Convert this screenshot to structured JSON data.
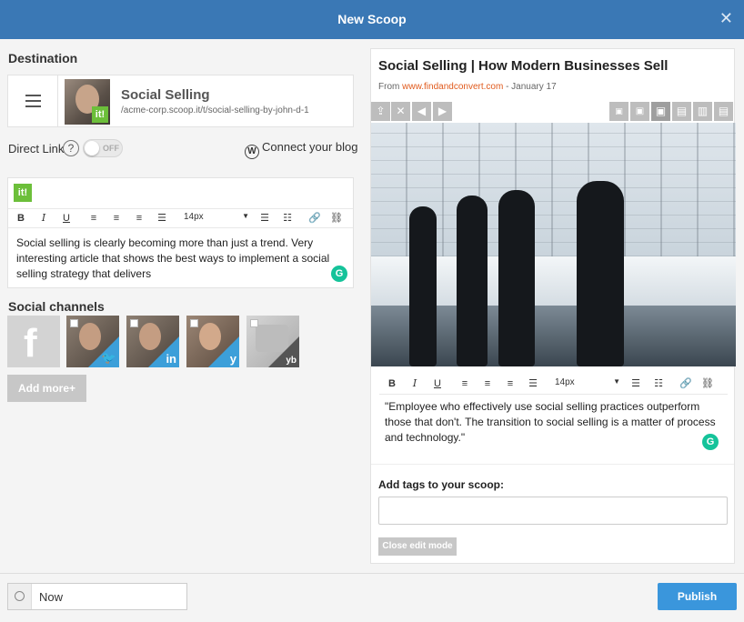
{
  "header": {
    "title": "New Scoop",
    "close_icon": "close-icon"
  },
  "destination": {
    "section_title": "Destination",
    "topic_name": "Social Selling",
    "topic_url": "/acme-corp.scoop.it/t/social-selling-by-john-d-1",
    "badge": "it!"
  },
  "direct_link": {
    "label": "Direct Link",
    "help": "?",
    "toggle": "OFF",
    "connect_blog": "Connect your blog"
  },
  "insight_editor": {
    "badge": "it!",
    "toolbar": {
      "bold": "B",
      "italic": "I",
      "underline": "U",
      "font_size": "14px"
    },
    "text": "Social selling is clearly becoming more than just a trend. Very interesting article that shows the best ways to implement a social selling strategy that delivers",
    "grammarly": "G"
  },
  "social": {
    "section_title": "Social channels",
    "channels": [
      {
        "name": "Facebook",
        "icon": "f"
      },
      {
        "name": "Twitter",
        "icon": "twitter-icon"
      },
      {
        "name": "LinkedIn",
        "icon": "in"
      },
      {
        "name": "Yammer",
        "icon": "y"
      },
      {
        "name": "Xing",
        "icon": "yb"
      }
    ],
    "add_more": "Add more+"
  },
  "article": {
    "title": "Social Selling | How Modern Businesses Sell",
    "from_label": "From",
    "source": "www.findandconvert.com",
    "date": "- January 17",
    "quote": "\"Employee who effectively use social selling practices outperform those that don't. The transition to social selling is a matter of process and technology.\"",
    "toolbar": {
      "bold": "B",
      "italic": "I",
      "underline": "U",
      "font_size": "14px"
    },
    "grammarly": "G",
    "tags_label": "Add tags to your scoop:",
    "tags_value": "",
    "close_edit": "Close edit mode"
  },
  "footer": {
    "time_value": "Now",
    "publish": "Publish"
  },
  "colors": {
    "header": "#3a78b5",
    "publish": "#3a96dc",
    "brand_green": "#6cbf3a",
    "source_link": "#e05a1c"
  }
}
